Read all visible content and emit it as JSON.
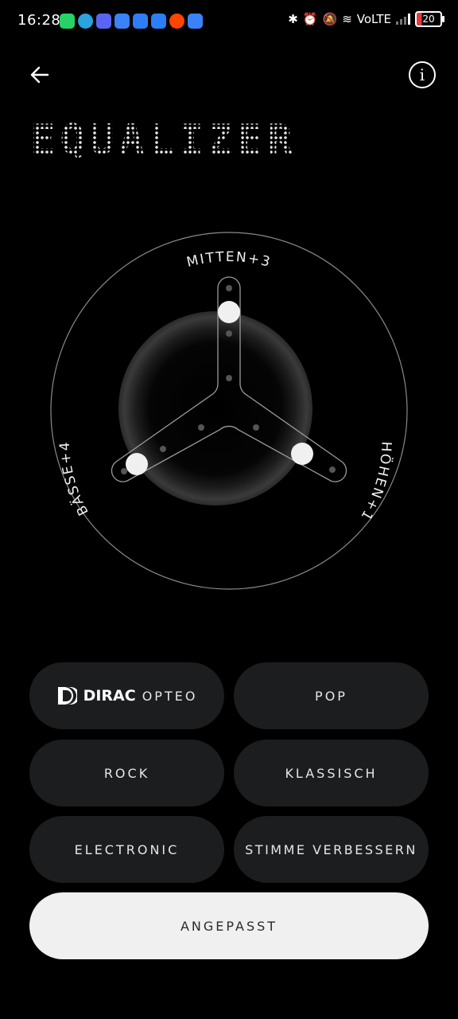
{
  "status_bar": {
    "time": "16:28",
    "network": "VoLTE",
    "battery": "20",
    "notification_icons": [
      "whatsapp-icon",
      "telegram-icon",
      "discord-icon",
      "clipboard-icon",
      "youtube-icon",
      "bluetooth-app-icon",
      "reddit-icon",
      "mail-icon"
    ],
    "notification_colors": [
      "#25d366",
      "#2aa3df",
      "#5865f2",
      "#3b82f6",
      "#2d7df6",
      "#2d7df6",
      "#ff4500",
      "#3b82f6"
    ]
  },
  "header": {
    "title": "EQUALIZER",
    "info_symbol": "i"
  },
  "equalizer": {
    "mids_label": "MITTEN+3",
    "bass_label": "BÄSSE+4",
    "treble_label": "HÖHEN+1",
    "mids_value": 3,
    "bass_value": 4,
    "treble_value": 1
  },
  "presets": {
    "dirac_brand": "DIRAC",
    "dirac_label": "OPTEO",
    "pop": "POP",
    "rock": "ROCK",
    "classical": "KLASSISCH",
    "electronic": "ELECTRONIC",
    "voice": "STIMME VERBESSERN",
    "custom": "ANGEPASST"
  }
}
